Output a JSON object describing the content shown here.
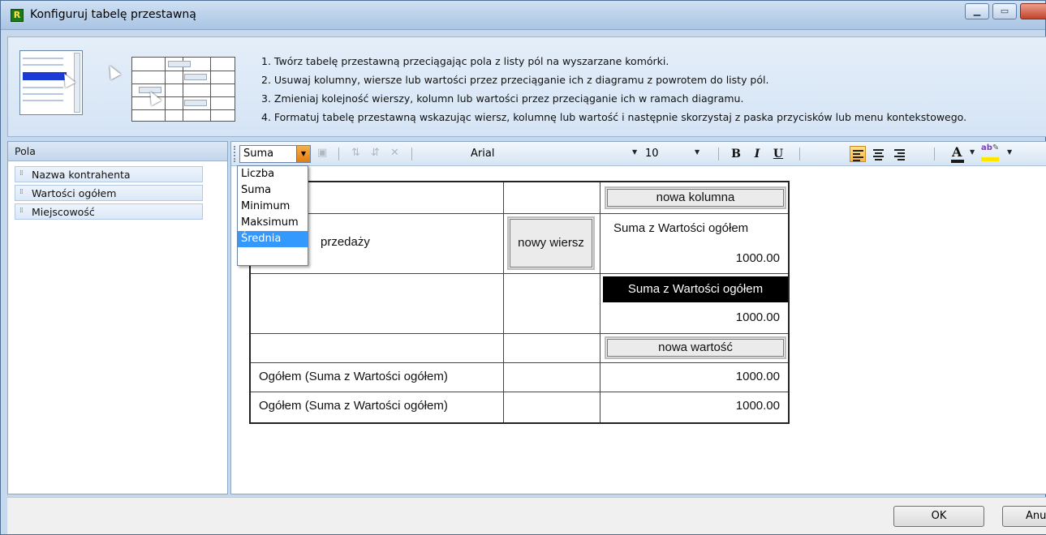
{
  "window": {
    "title": "Konfiguruj tabelę przestawną",
    "app_icon_letter": "R"
  },
  "instructions": [
    "1. Twórz tabelę przestawną przeciągając pola z listy pól na wyszarzane komórki.",
    "2. Usuwaj kolumny, wiersze lub wartości przez przeciąganie ich z diagramu z powrotem do listy pól.",
    "3. Zmieniaj kolejność wierszy, kolumn lub wartości przez przeciąganie ich w ramach diagramu.",
    "4. Formatuj tabelę przestawną wskazując wiersz, kolumnę lub wartość i następnie skorzystaj z paska przycisków lub menu kontekstowego."
  ],
  "fields_panel": {
    "header": "Pola",
    "items": [
      {
        "label": "Nazwa kontrahenta"
      },
      {
        "label": "Wartości ogółem"
      },
      {
        "label": "Miejscowość"
      }
    ]
  },
  "toolbar": {
    "function_value": "Suma",
    "font_value": "Arial",
    "size_value": "10",
    "bold": "B",
    "italic": "I",
    "underline": "U",
    "font_color_letter": "A",
    "highlight_label": "ab"
  },
  "function_dropdown": {
    "options": [
      "Liczba",
      "Suma",
      "Minimum",
      "Maksimum",
      "Średnia"
    ],
    "selected": "Średnia"
  },
  "pivot": {
    "new_column": "nowa kolumna",
    "row_label_partial": "przedaży",
    "new_row": "nowy wiersz",
    "value_header_1": "Suma z Wartości ogółem",
    "value_1": "1000.00",
    "value_header_2": "Suma z Wartości ogółem",
    "value_2": "1000.00",
    "new_value": "nowa wartość",
    "total_label_1": "Ogółem (Suma z Wartości ogółem)",
    "total_value_1": "1000.00",
    "total_label_2": "Ogółem (Suma z Wartości ogółem)",
    "total_value_2": "1000.00"
  },
  "buttons": {
    "ok": "OK",
    "cancel": "Anulu"
  }
}
